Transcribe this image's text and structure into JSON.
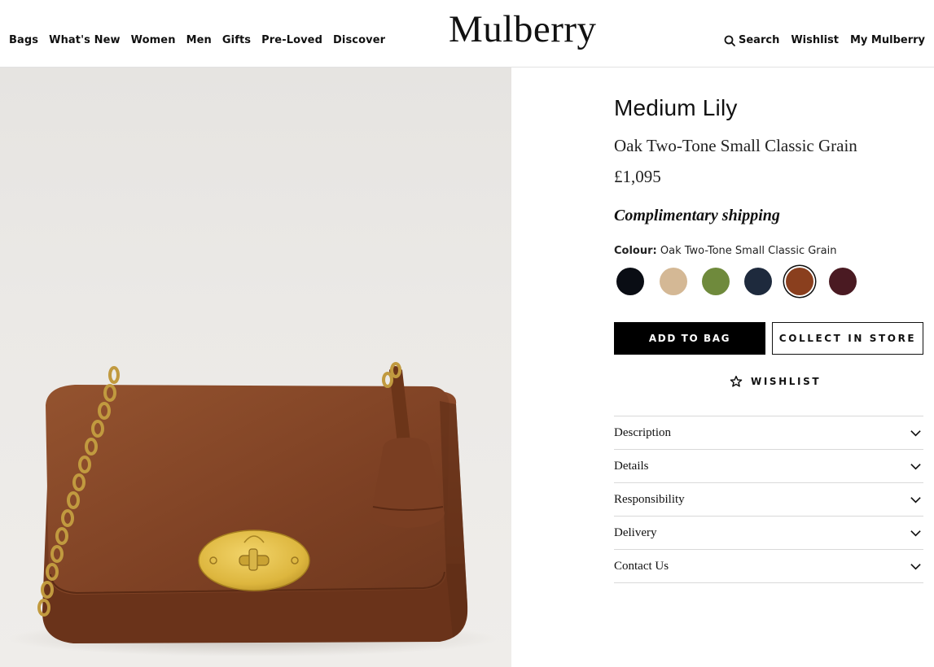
{
  "header": {
    "logo": "Mulberry",
    "nav_left": [
      "Bags",
      "What's New",
      "Women",
      "Men",
      "Gifts",
      "Pre-Loved",
      "Discover"
    ],
    "search_label": "Search",
    "wishlist_label": "Wishlist",
    "account_label": "My Mulberry"
  },
  "product": {
    "name": "Medium Lily",
    "variant": "Oak Two-Tone Small Classic Grain",
    "price": "£1,095",
    "shipping": "Complimentary shipping",
    "colour_label": "Colour:",
    "colour_value": "Oak Two-Tone Small Classic Grain",
    "swatches": [
      {
        "color": "#0a0d14",
        "selected": false
      },
      {
        "color": "#d4b895",
        "selected": false
      },
      {
        "color": "#6f8a3c",
        "selected": false
      },
      {
        "color": "#1e2a3d",
        "selected": false
      },
      {
        "color": "#8a3f1e",
        "selected": true
      },
      {
        "color": "#4a1a22",
        "selected": false
      }
    ]
  },
  "actions": {
    "add_to_bag": "ADD TO BAG",
    "collect_in_store": "COLLECT IN STORE",
    "wishlist": "WISHLIST"
  },
  "accordion": [
    "Description",
    "Details",
    "Responsibility",
    "Delivery",
    "Contact Us"
  ]
}
